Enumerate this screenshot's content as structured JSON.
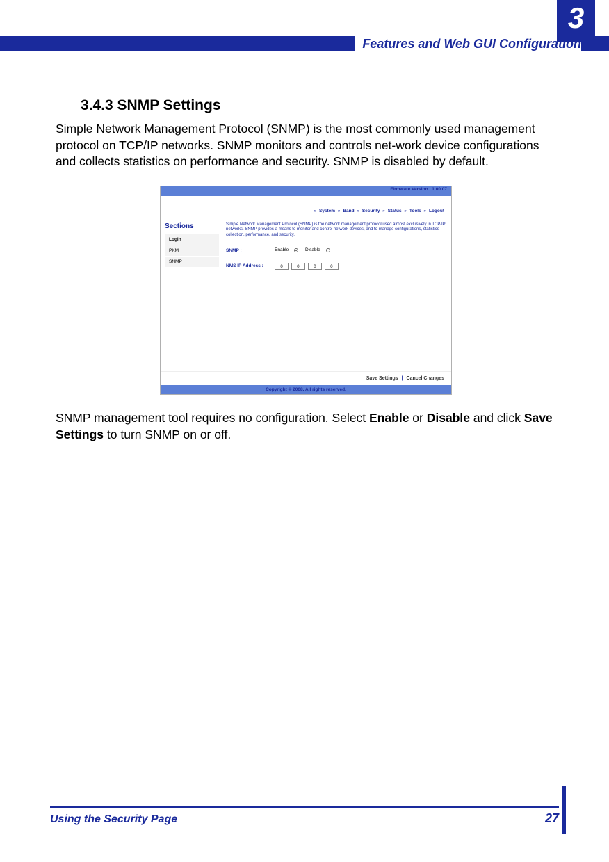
{
  "header": {
    "chapter_number": "3",
    "chapter_title": "Features and Web GUI Configuration"
  },
  "content": {
    "section_heading": "3.4.3 SNMP Settings",
    "paragraph1": "Simple Network Management Protocol (SNMP) is the most commonly used management protocol on TCP/IP networks. SNMP monitors and controls net-work device configurations and collects statistics on performance and security. SNMP is disabled by default.",
    "paragraph2_pre": "SNMP management tool requires no configuration. Select ",
    "paragraph2_b1": "Enable",
    "paragraph2_mid1": " or ",
    "paragraph2_b2": "Disable",
    "paragraph2_mid2": " and click ",
    "paragraph2_b3": "Save Settings",
    "paragraph2_post": " to turn SNMP on or off."
  },
  "screenshot": {
    "firmware_label": "Firmware Version : 1.00.07",
    "nav_items": [
      "System",
      "Band",
      "Security",
      "Status",
      "Tools",
      "Logout"
    ],
    "sidebar_title": "Sections",
    "sidebar_items": [
      "Login",
      "PKM",
      "SNMP"
    ],
    "description": "Simple Network Management Protocol (SNMP) is the network management protocol used almost exclusively in TCP/IP networks. SNMP provides a means to monitor and control network devices, and to manage configurations, statistics collection, performance, and security.",
    "snmp_label": "SNMP :",
    "enable_label": "Enable",
    "disable_label": "Disable",
    "nms_label": "NMS IP Address :",
    "ip_octets": [
      "0",
      "0",
      "0",
      "0"
    ],
    "save_button": "Save Settings",
    "cancel_button": "Cancel Changes",
    "copyright": "Copyright © 2008. All rights reserved."
  },
  "footer": {
    "left": "Using the Security Page",
    "page_number": "27"
  }
}
